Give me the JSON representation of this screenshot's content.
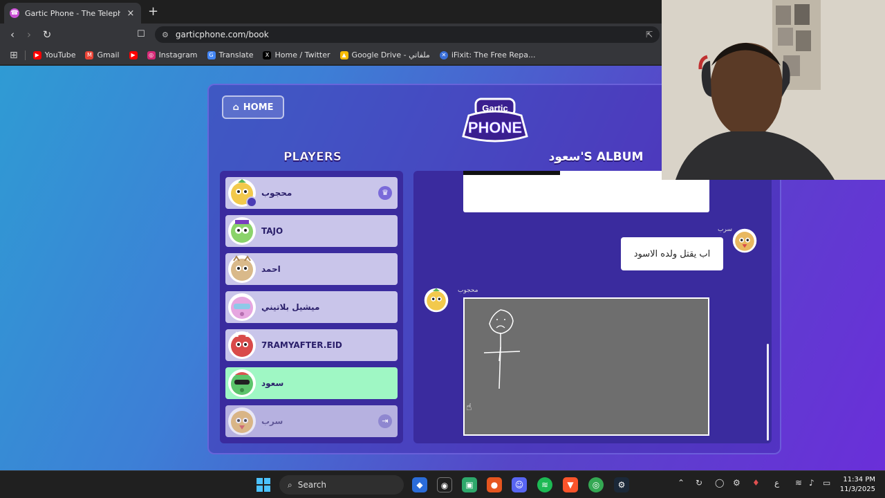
{
  "browser": {
    "tab_title": "Gartic Phone - The Telephone Ga",
    "tab_close": "×",
    "new_tab": "+",
    "url": "garticphone.com/book",
    "bookmarks": [
      {
        "label": "YouTube",
        "color": "#ff0000"
      },
      {
        "label": "Gmail",
        "color": "#ea4335"
      },
      {
        "label": "",
        "color": "#ff0000"
      },
      {
        "label": "Instagram",
        "color": "#d62976"
      },
      {
        "label": "Translate",
        "color": "#4285f4"
      },
      {
        "label": "Home / Twitter",
        "color": "#000000"
      },
      {
        "label": "Google Drive - ملفاتي",
        "color": "#fbbc04"
      },
      {
        "label": "iFixit: The Free Repa...",
        "color": "#3a6fd8"
      }
    ]
  },
  "game": {
    "home_label": "HOME",
    "logo_top": "Gartic",
    "logo_bottom": "PHONE",
    "players_title": "PLAYERS",
    "album_title": "سعود'S ALBUM",
    "players": [
      {
        "name": "محجوب",
        "state": "host",
        "color": "#f2c94c"
      },
      {
        "name": "TAJO",
        "state": "normal",
        "color": "#8bd36b"
      },
      {
        "name": "احمد",
        "state": "normal",
        "color": "#d9b98a"
      },
      {
        "name": "ميشيل بلاتيني",
        "state": "normal",
        "color": "#e6a6e0"
      },
      {
        "name": "7RAMYAFTER.EID",
        "state": "normal",
        "color": "#d94a4a"
      },
      {
        "name": "سعود",
        "state": "active",
        "color": "#5cc46b"
      },
      {
        "name": "سرب",
        "state": "left",
        "color": "#e8b860"
      }
    ],
    "messages": [
      {
        "author": "سرب",
        "text": "اب يقتل ولده الاسود"
      },
      {
        "author": "محجوب",
        "text": ""
      }
    ]
  },
  "taskbar": {
    "search_label": "Search",
    "lang": "ع",
    "time": "11:34 PM",
    "date": "11/3/2025"
  }
}
